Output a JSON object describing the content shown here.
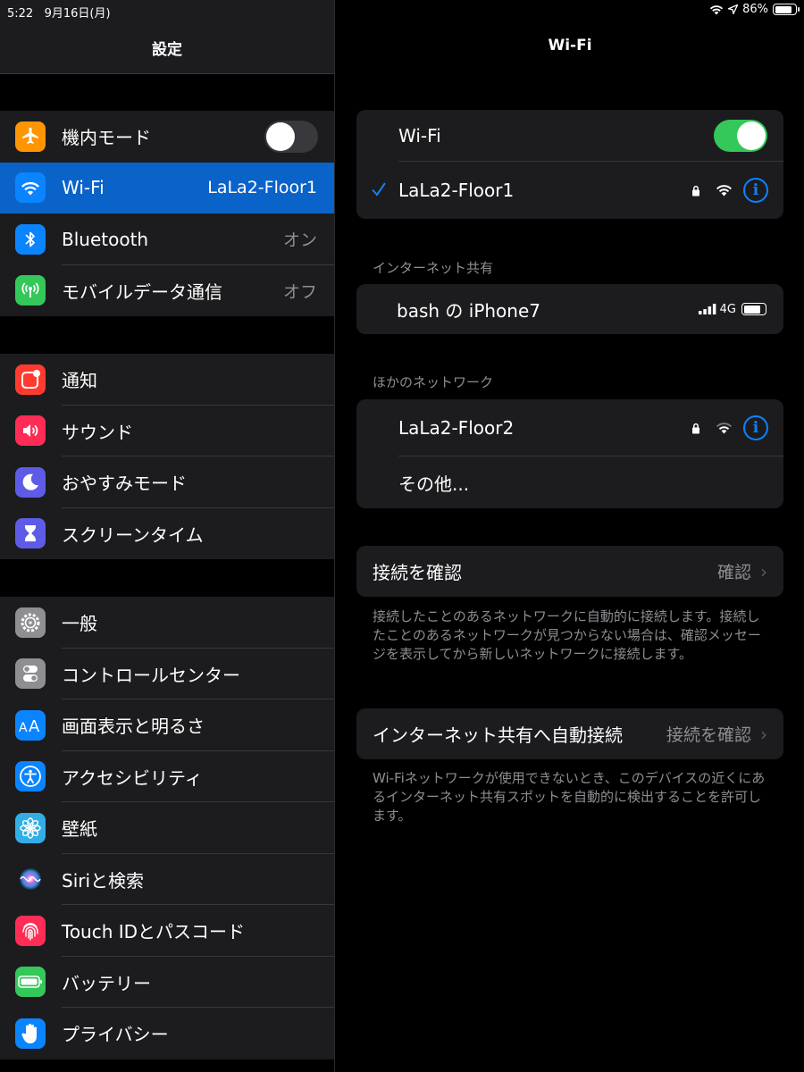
{
  "status_bar": {
    "time": "5:22",
    "date": "9月16日(月)",
    "battery_percent": "86%",
    "battery_level": 0.86
  },
  "sidebar": {
    "title": "設定",
    "groups": [
      [
        {
          "label": "機内モード",
          "icon": "airplane-icon",
          "color": "#ff9500",
          "toggle": "off"
        },
        {
          "label": "Wi-Fi",
          "icon": "wifi-icon",
          "color": "#0a84ff",
          "value": "LaLa2-Floor1",
          "selected": true
        },
        {
          "label": "Bluetooth",
          "icon": "bluetooth-icon",
          "color": "#0a84ff",
          "value": "オン"
        },
        {
          "label": "モバイルデータ通信",
          "icon": "antenna-icon",
          "color": "#34c759",
          "value": "オフ"
        }
      ],
      [
        {
          "label": "通知",
          "icon": "notifications-icon",
          "color": "#ff3b30"
        },
        {
          "label": "サウンド",
          "icon": "speaker-icon",
          "color": "#ff2d55"
        },
        {
          "label": "おやすみモード",
          "icon": "moon-icon",
          "color": "#5e5ce6"
        },
        {
          "label": "スクリーンタイム",
          "icon": "hourglass-icon",
          "color": "#5e5ce6"
        }
      ],
      [
        {
          "label": "一般",
          "icon": "gear-icon",
          "color": "#8e8e93"
        },
        {
          "label": "コントロールセンター",
          "icon": "switches-icon",
          "color": "#8e8e93"
        },
        {
          "label": "画面表示と明るさ",
          "icon": "text-size-icon",
          "color": "#0a84ff"
        },
        {
          "label": "アクセシビリティ",
          "icon": "accessibility-icon",
          "color": "#0a84ff"
        },
        {
          "label": "壁紙",
          "icon": "flower-icon",
          "color": "#32ade6"
        },
        {
          "label": "Siriと検索",
          "icon": "siri-icon",
          "color": "#1c1c1e"
        },
        {
          "label": "Touch IDとパスコード",
          "icon": "fingerprint-icon",
          "color": "#ff2d55"
        },
        {
          "label": "バッテリー",
          "icon": "battery-icon",
          "color": "#34c759"
        },
        {
          "label": "プライバシー",
          "icon": "hand-icon",
          "color": "#0a84ff"
        }
      ]
    ]
  },
  "main": {
    "title": "Wi-Fi",
    "wifi_row_label": "Wi-Fi",
    "wifi_enabled": true,
    "connected_network": "LaLa2-Floor1",
    "hotspot_section": "インターネット共有",
    "hotspot_name": "bash の iPhone7",
    "hotspot_signal": "4G",
    "other_section": "ほかのネットワーク",
    "other_network": "LaLa2-Floor2",
    "other_label": "その他...",
    "ask_join_label": "接続を確認",
    "ask_join_value": "確認",
    "ask_join_footnote": "接続したことのあるネットワークに自動的に接続します。接続したことのあるネットワークが見つからない場合は、確認メッセージを表示してから新しいネットワークに接続します。",
    "auto_hotspot_label": "インターネット共有へ自動接続",
    "auto_hotspot_value": "接続を確認",
    "auto_hotspot_footnote": "Wi-Fiネットワークが使用できないとき、このデバイスの近くにあるインターネット共有スポットを自動的に検出することを許可します。"
  }
}
